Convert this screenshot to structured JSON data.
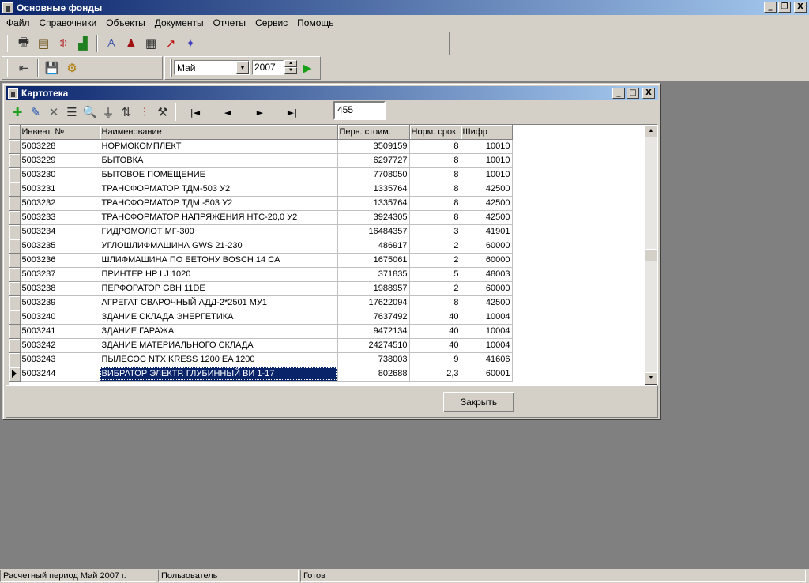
{
  "window": {
    "title": "Основные фонды",
    "minimize": "_",
    "restore": "❐",
    "close": "X"
  },
  "menu": [
    "Файл",
    "Справочники",
    "Объекты",
    "Документы",
    "Отчеты",
    "Сервис",
    "Помощь"
  ],
  "toolbar1": {
    "icons": [
      "printer-icon",
      "book-icon",
      "tree-icon",
      "chart-bars-icon",
      "person-icon",
      "people-icon",
      "report-icon",
      "line-chart-icon",
      "diamond-icon"
    ]
  },
  "toolbar2": {
    "icons": [
      "exit-icon",
      "save-icon",
      "calculate-icon"
    ],
    "month": "Май",
    "year": "2007",
    "run_icon": "play-icon"
  },
  "child": {
    "title": "Картотека",
    "toolbar_icons": [
      "add-icon",
      "edit-icon",
      "delete-icon",
      "list-icon",
      "find-icon",
      "filter-icon",
      "sort-icon",
      "columns-icon",
      "settings-icon"
    ],
    "nav": {
      "first": "|◄",
      "prev": "◄",
      "next": "►",
      "last": "►|",
      "record": "455"
    },
    "columns": [
      "Инвент. №",
      "Наименование",
      "Перв. стоим.",
      "Норм. срок",
      "Шифр"
    ],
    "rows": [
      [
        "5003228",
        "НОРМОКОМПЛЕКТ",
        "3509159",
        "8",
        "10010"
      ],
      [
        "5003229",
        "БЫТОВКА",
        "6297727",
        "8",
        "10010"
      ],
      [
        "5003230",
        "БЫТОВОЕ ПОМЕЩЕНИЕ",
        "7708050",
        "8",
        "10010"
      ],
      [
        "5003231",
        "ТРАНСФОРМАТОР  ТДМ-503 У2",
        "1335764",
        "8",
        "42500"
      ],
      [
        "5003232",
        "ТРАНСФОРМАТОР ТДМ -503 У2",
        "1335764",
        "8",
        "42500"
      ],
      [
        "5003233",
        "ТРАНСФОРМАТОР НАПРЯЖЕНИЯ НТС-20,0 У2",
        "3924305",
        "8",
        "42500"
      ],
      [
        "5003234",
        "ГИДРОМОЛОТ МГ-300",
        "16484357",
        "3",
        "41901"
      ],
      [
        "5003235",
        "УГЛОШЛИФМАШИНА GWS 21-230",
        "486917",
        "2",
        "60000"
      ],
      [
        "5003236",
        "ШЛИФМАШИНА ПО БЕТОНУ BOSCH 14 CA",
        "1675061",
        "2",
        "60000"
      ],
      [
        "5003237",
        "ПРИНТЕР HP LJ 1020",
        "371835",
        "5",
        "48003"
      ],
      [
        "5003238",
        "ПЕРФОРАТОР GBH 11DE",
        "1988957",
        "2",
        "60000"
      ],
      [
        "5003239",
        "АГРЕГАТ СВАРОЧНЫЙ АДД-2*2501 МУ1",
        "17622094",
        "8",
        "42500"
      ],
      [
        "5003240",
        "ЗДАНИЕ СКЛАДА ЭНЕРГЕТИКА",
        "7637492",
        "40",
        "10004"
      ],
      [
        "5003241",
        "ЗДАНИЕ ГАРАЖА",
        "9472134",
        "40",
        "10004"
      ],
      [
        "5003242",
        "ЗДАНИЕ МАТЕРИАЛЬНОГО СКЛАДА",
        "24274510",
        "40",
        "10004"
      ],
      [
        "5003243",
        "ПЫЛЕСОС NTX KRESS 1200 EA 1200",
        "738003",
        "9",
        "41606"
      ],
      [
        "5003244",
        "ВИБРАТОР ЭЛЕКТР. ГЛУБИННЫЙ ВИ 1-17",
        "802688",
        "2,3",
        "60001"
      ]
    ],
    "selected_row": 16,
    "close_label": "Закрыть"
  },
  "status": [
    "Расчетный период Май 2007 г.",
    "Пользователь",
    "Готов"
  ]
}
